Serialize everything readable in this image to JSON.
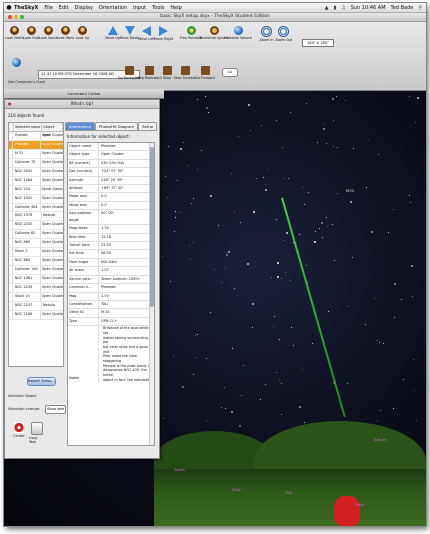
{
  "menubar": {
    "app": "TheSkyX",
    "items": [
      "File",
      "Edit",
      "Display",
      "Orientation",
      "Input",
      "Tools",
      "Help"
    ],
    "clock": "Sun 10:46 AM",
    "user": "Ted Bade"
  },
  "window": {
    "title": "basic SkyX setup.skyx - TheSkyX Student Edition"
  },
  "toolbar": {
    "look_buttons": [
      "Look North",
      "Look East",
      "Look South",
      "Look West",
      "Look Up"
    ],
    "move_buttons": [
      "Move Up",
      "Move Down",
      "Move Left",
      "Move Right"
    ],
    "rotation_buttons": [
      "Free Rotation",
      "Terrestrial Sphere",
      "Celestial Sphere"
    ],
    "zoom_buttons": [
      "Zoom In",
      "Zoom Out"
    ],
    "fov": "180° x 180°",
    "clock_label": "Use Computer's Clock",
    "datetime": "11 47 10 PM STD    December 16 2008    AD",
    "step_buttons": [
      "Go Backward",
      "Step Backward",
      "Stop",
      "Step Forward",
      "Go Forward"
    ],
    "speed": "1x"
  },
  "command_center": {
    "label": "Command Center"
  },
  "panel": {
    "title": "What's Up?",
    "found": "216 objects found",
    "columns": [
      "Selected name",
      "Object type"
    ],
    "rows": [
      {
        "n": "",
        "name": "Hyades",
        "type": "Open Cluster"
      },
      {
        "n": "",
        "name": "Pleiades",
        "type": "Open Cluster"
      },
      {
        "n": "",
        "name": "M 31",
        "type": "Open Cluster"
      },
      {
        "n": "",
        "name": "Collinder 70",
        "type": "Open Cluster"
      },
      {
        "n": "",
        "name": "NGC 2632",
        "type": "Open Cluster"
      },
      {
        "n": "",
        "name": "NGC 1264",
        "type": "Open Cluster"
      },
      {
        "n": "",
        "name": "NGC 224",
        "type": "Spiral Galaxy"
      },
      {
        "n": "",
        "name": "NGC 1502",
        "type": "Open Cluster"
      },
      {
        "n": "",
        "name": "Collinder 464",
        "type": "Open Cluster"
      },
      {
        "n": "",
        "name": "NGC 1976",
        "type": "Nebula"
      },
      {
        "n": "",
        "name": "NGC 2232",
        "type": "Open Cluster"
      },
      {
        "n": "",
        "name": "Collinder 62",
        "type": "Open Cluster"
      },
      {
        "n": "",
        "name": "NGC 869",
        "type": "Open Cluster"
      },
      {
        "n": "",
        "name": "Stock 2",
        "type": "Open Cluster"
      },
      {
        "n": "",
        "name": "NGC 884",
        "type": "Open Cluster"
      },
      {
        "n": "",
        "name": "Collinder 106",
        "type": "Open Cluster"
      },
      {
        "n": "",
        "name": "NGC 1981",
        "type": "Open Cluster"
      },
      {
        "n": "",
        "name": "NGC 2244",
        "type": "Open Cluster"
      },
      {
        "n": "",
        "name": "Stock 10",
        "type": "Open Cluster"
      },
      {
        "n": "",
        "name": "NGC 2237",
        "type": "Nebula"
      },
      {
        "n": "",
        "name": "NGC 2168",
        "type": "Open Cluster"
      }
    ],
    "tabs": [
      "Information",
      "Photo/HR Diagram",
      "Setup"
    ],
    "info_title": "Information for selected object:",
    "info": [
      {
        "k": "Object name",
        "v": "Pleiades"
      },
      {
        "k": "Object type",
        "v": "Open Cluster"
      },
      {
        "k": "RA (current)",
        "v": "03h 47m 54s"
      },
      {
        "k": "Dec (current)",
        "v": "+24° 07' 50\""
      },
      {
        "k": "Azimuth",
        "v": "216° 20' 39\""
      },
      {
        "k": "Altitude",
        "v": "+69° 37' 42\""
      },
      {
        "k": "Major axis",
        "v": "0.0"
      },
      {
        "k": "Minor axis",
        "v": "0.0"
      },
      {
        "k": "Axis position angle",
        "v": "00° 00'"
      },
      {
        "k": "Magnitude",
        "v": "1.50"
      },
      {
        "k": "Rise time",
        "v": "15:16"
      },
      {
        "k": "Transit time",
        "v": "22:53"
      },
      {
        "k": "Set time",
        "v": "06:34"
      },
      {
        "k": "Hour angle",
        "v": "00h 54m"
      },
      {
        "k": "Air mass",
        "v": "1.07"
      },
      {
        "k": "Source cata...",
        "v": "Tomm Lorenzin 2000+"
      },
      {
        "k": "Common n...",
        "v": "Pleiades"
      },
      {
        "k": "Mag",
        "v": "1.50"
      },
      {
        "k": "Constellation",
        "v": "TAU"
      },
      {
        "k": "Other ID",
        "v": "M 45"
      },
      {
        "k": "Type",
        "v": "OPN CL+"
      }
    ],
    "notes_label": "Notes",
    "notes": [
      "Brilliance of the blue-white sta",
      "makes seeing surrounding, pal",
      "but clear skies and a good wid",
      "filter make the view staggering",
      "Merope is the most easily dist",
      "designation NGC 435; the entire",
      "object in fact. the nebulosity"
    ],
    "report_button": "Report Setup...",
    "selected_object": "Selected Object",
    "selection_change": "Selection change:",
    "selection_option": "Show sele",
    "actions": [
      "Center",
      "Copy Text"
    ]
  },
  "sky": {
    "labels": [
      "M31",
      "Saturn",
      "South",
      "SSW",
      "SW",
      "Pool"
    ]
  }
}
